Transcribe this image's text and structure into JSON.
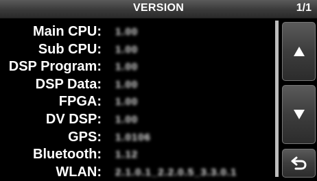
{
  "header": {
    "title": "VERSION",
    "page_indicator": "1/1"
  },
  "rows": [
    {
      "label": "Main CPU:",
      "value": "1.00"
    },
    {
      "label": "Sub CPU:",
      "value": "1.00"
    },
    {
      "label": "DSP Program:",
      "value": "1.00"
    },
    {
      "label": "DSP Data:",
      "value": "1.00"
    },
    {
      "label": "FPGA:",
      "value": "1.00"
    },
    {
      "label": "DV DSP:",
      "value": "1.00"
    },
    {
      "label": "GPS:",
      "value": "1.0106"
    },
    {
      "label": "Bluetooth:",
      "value": "1.12"
    },
    {
      "label": "WLAN:",
      "value": "2.1.0.1_2.2.0.5_3.3.0.1"
    }
  ],
  "buttons": {
    "up_icon": "triangle-up-icon",
    "down_icon": "triangle-down-icon",
    "back_icon": "return-arrow-icon"
  },
  "colors": {
    "background": "#000000",
    "text": "#ffffff",
    "titlebar": "#3a3a3a",
    "button": "#3d3d3d"
  }
}
